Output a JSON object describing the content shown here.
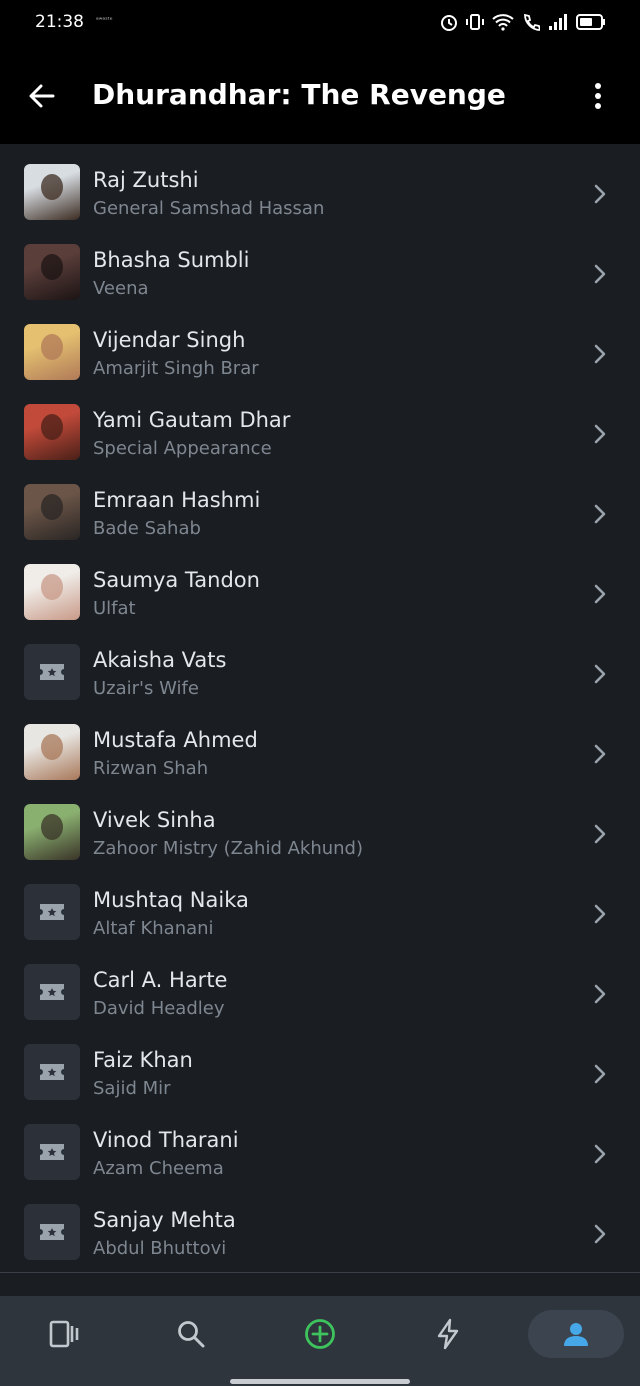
{
  "status_bar": {
    "time": "21:38",
    "tiny_text": "ᵃʷᵃˢᵗᵉ"
  },
  "app_bar": {
    "title": "Dhurandhar: The Revenge",
    "back_icon": "arrow-left-icon",
    "menu_icon": "more-vertical-icon"
  },
  "cast": [
    {
      "name": "Raj Zutshi",
      "role": "General Samshad Hassan",
      "photo": "photo",
      "colors": [
        "#d8dde2",
        "#3c2c22"
      ]
    },
    {
      "name": "Bhasha Sumbli",
      "role": "Veena",
      "photo": "photo",
      "colors": [
        "#5a3e3a",
        "#1c1414"
      ]
    },
    {
      "name": "Vijendar Singh",
      "role": "Amarjit Singh Brar",
      "photo": "photo",
      "colors": [
        "#e4c070",
        "#b07a58"
      ]
    },
    {
      "name": "Yami Gautam Dhar",
      "role": "Special Appearance",
      "photo": "photo",
      "colors": [
        "#c24a3a",
        "#4a2018"
      ]
    },
    {
      "name": "Emraan Hashmi",
      "role": "Bade Sahab",
      "photo": "photo",
      "colors": [
        "#6b5548",
        "#2a2624"
      ]
    },
    {
      "name": "Saumya Tandon",
      "role": "Ulfat",
      "photo": "photo",
      "colors": [
        "#f0ece8",
        "#c89a88"
      ]
    },
    {
      "name": "Akaisha Vats",
      "role": "Uzair's Wife",
      "photo": "placeholder",
      "colors": [
        "#2c3139",
        "#2c3139"
      ]
    },
    {
      "name": "Mustafa Ahmed",
      "role": "Rizwan Shah",
      "photo": "photo",
      "colors": [
        "#e8e6e2",
        "#a8785a"
      ]
    },
    {
      "name": "Vivek Sinha",
      "role": "Zahoor Mistry (Zahid Akhund)",
      "photo": "photo",
      "colors": [
        "#8ab070",
        "#3a3428"
      ]
    },
    {
      "name": "Mushtaq Naika",
      "role": "Altaf Khanani",
      "photo": "placeholder",
      "colors": [
        "#2c3139",
        "#2c3139"
      ]
    },
    {
      "name": "Carl A. Harte",
      "role": "David Headley",
      "photo": "placeholder",
      "colors": [
        "#2c3139",
        "#2c3139"
      ]
    },
    {
      "name": "Faiz Khan",
      "role": "Sajid Mir",
      "photo": "placeholder",
      "colors": [
        "#2c3139",
        "#2c3139"
      ]
    },
    {
      "name": "Vinod Tharani",
      "role": "Azam Cheema",
      "photo": "placeholder",
      "colors": [
        "#2c3139",
        "#2c3139"
      ]
    },
    {
      "name": "Sanjay Mehta",
      "role": "Abdul Bhuttovi",
      "photo": "placeholder",
      "colors": [
        "#2c3139",
        "#2c3139"
      ]
    }
  ],
  "bottom_nav": [
    {
      "icon": "tv-shows-icon",
      "active": false
    },
    {
      "icon": "search-icon",
      "active": false
    },
    {
      "icon": "add-circle-icon",
      "active": false
    },
    {
      "icon": "lightning-icon",
      "active": false
    },
    {
      "icon": "profile-icon",
      "active": true
    }
  ],
  "colors": {
    "background": "#1a1d22",
    "accent_green": "#3ec45c",
    "accent_blue": "#46a8e8",
    "primary_text": "#e3e6ea",
    "secondary_text": "#7e8690"
  }
}
